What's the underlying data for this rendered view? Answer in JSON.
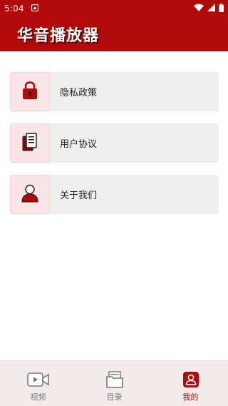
{
  "status_bar": {
    "time": "5:04"
  },
  "header": {
    "title": "华音播放器"
  },
  "menu": [
    {
      "label": "隐私政策",
      "icon": "lock-icon"
    },
    {
      "label": "用户协议",
      "icon": "document-icon"
    },
    {
      "label": "关于我们",
      "icon": "user-icon"
    }
  ],
  "bottom_nav": [
    {
      "label": "视频",
      "icon": "video-camera-icon",
      "active": false
    },
    {
      "label": "目录",
      "icon": "folder-icon",
      "active": false
    },
    {
      "label": "我的",
      "icon": "profile-icon",
      "active": true
    }
  ],
  "colors": {
    "accent": "#b20a0a",
    "icon_box": "#f8e6e6",
    "item_bg": "#efefef",
    "nav_bg": "#f3eaea"
  }
}
